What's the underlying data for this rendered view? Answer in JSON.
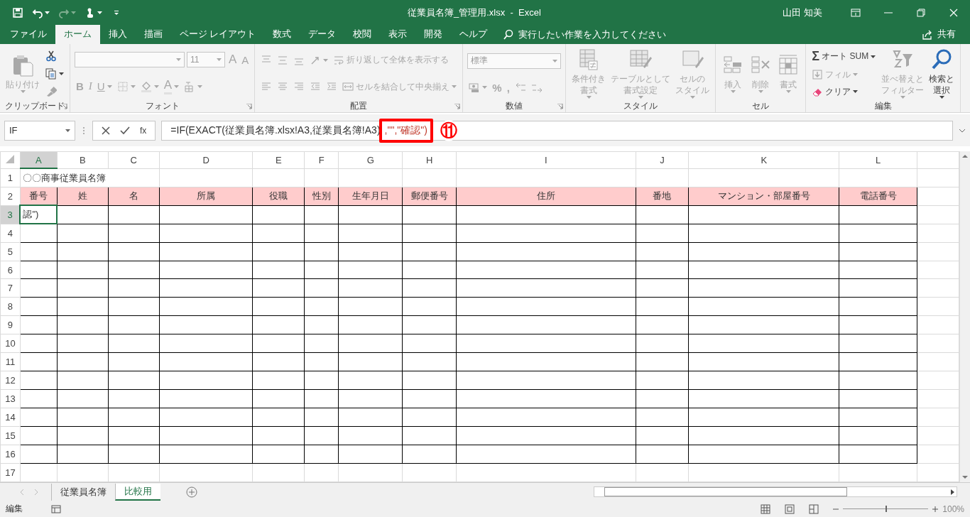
{
  "title_bar": {
    "title": "従業員名簿_管理用.xlsx  -  Excel",
    "user": "山田 知美"
  },
  "ribbon_tabs": [
    {
      "label": "ファイル",
      "selected": false
    },
    {
      "label": "ホーム",
      "selected": true
    },
    {
      "label": "挿入",
      "selected": false
    },
    {
      "label": "描画",
      "selected": false
    },
    {
      "label": "ページ レイアウト",
      "selected": false
    },
    {
      "label": "数式",
      "selected": false
    },
    {
      "label": "データ",
      "selected": false
    },
    {
      "label": "校閲",
      "selected": false
    },
    {
      "label": "表示",
      "selected": false
    },
    {
      "label": "開発",
      "selected": false
    },
    {
      "label": "ヘルプ",
      "selected": false
    }
  ],
  "tell_me": {
    "placeholder": "実行したい作業を入力してください"
  },
  "share": "共有",
  "ribbon_groups": [
    {
      "label": "クリップボード",
      "launcher": true,
      "sections": [
        {
          "rows": [
            [
              {
                "kind": "paste",
                "lines": [
                  "貼り付け"
                ],
                "disabled": true
              }
            ]
          ]
        },
        {
          "rows": [
            [
              {
                "kind": "cut",
                "disabled": false
              }
            ],
            [
              {
                "kind": "copy",
                "disabled": false
              }
            ],
            [
              {
                "kind": "painter",
                "disabled": true
              }
            ]
          ]
        }
      ]
    },
    {
      "label": "フォント",
      "launcher": true,
      "sections": [
        {
          "rows": [
            [
              {
                "kind": "fontname",
                "disabled": true
              },
              {
                "kind": "fontsize",
                "label": "11",
                "disabled": true
              },
              {
                "kind": "grow",
                "label": "A",
                "disabled": true
              },
              {
                "kind": "shrink",
                "label": "A",
                "disabled": true
              }
            ],
            [
              {
                "kind": "bold",
                "label": "B",
                "disabled": true
              },
              {
                "kind": "italic",
                "label": "I",
                "disabled": true
              },
              {
                "kind": "underline",
                "label": "U",
                "disabled": true
              },
              {
                "kind": "borders",
                "disabled": true
              },
              {
                "kind": "fill",
                "disabled": true
              },
              {
                "kind": "fontcolor",
                "label": "A",
                "disabled": true
              },
              {
                "kind": "phonetic",
                "disabled": true
              }
            ]
          ]
        }
      ]
    },
    {
      "label": "配置",
      "launcher": true,
      "sections": [
        {
          "rows": [
            [
              {
                "kind": "aligntop",
                "disabled": true
              },
              {
                "kind": "alignmiddle",
                "disabled": true
              },
              {
                "kind": "alignbottom",
                "disabled": true
              },
              {
                "kind": "orientation",
                "disabled": true
              },
              {
                "kind": "wrap",
                "label": "折り返して全体を表示する",
                "disabled": true
              }
            ],
            [
              {
                "kind": "alignleft",
                "disabled": true
              },
              {
                "kind": "aligncenter",
                "disabled": true
              },
              {
                "kind": "alignright",
                "disabled": true
              },
              {
                "kind": "outdent",
                "disabled": true
              },
              {
                "kind": "indent",
                "disabled": true
              },
              {
                "kind": "merge",
                "label": "セルを結合して中央揃え",
                "disabled": true
              }
            ]
          ]
        }
      ]
    },
    {
      "label": "数値",
      "launcher": true,
      "sections": [
        {
          "rows": [
            [
              {
                "kind": "numformat",
                "label": "標準",
                "disabled": true
              }
            ],
            [
              {
                "kind": "currency",
                "disabled": true
              },
              {
                "kind": "glyph",
                "label": "%",
                "disabled": true
              },
              {
                "kind": "glyph",
                "label": ",",
                "disabled": true
              },
              {
                "kind": "incdec",
                "disabled": true
              },
              {
                "kind": "decdec",
                "disabled": true
              }
            ]
          ]
        }
      ]
    },
    {
      "label": "スタイル",
      "launcher": false,
      "sections": [
        {
          "rows": [
            [
              {
                "kind": "condformat",
                "lines": [
                  "条件付き",
                  "書式"
                ],
                "disabled": true
              },
              {
                "kind": "tablefmt",
                "lines": [
                  "テーブルとして",
                  "書式設定"
                ],
                "disabled": true
              },
              {
                "kind": "cellstyle",
                "lines": [
                  "セルの",
                  "スタイル"
                ],
                "disabled": true
              }
            ]
          ]
        }
      ]
    },
    {
      "label": "セル",
      "launcher": false,
      "sections": [
        {
          "rows": [
            [
              {
                "kind": "insert",
                "lines": [
                  "挿入"
                ],
                "disabled": true
              },
              {
                "kind": "delete",
                "lines": [
                  "削除"
                ],
                "disabled": true
              },
              {
                "kind": "format",
                "lines": [
                  "書式"
                ],
                "disabled": true
              }
            ]
          ]
        }
      ]
    },
    {
      "label": "編集",
      "launcher": false,
      "sections": [
        {
          "rows": [
            [
              {
                "kind": "autosum",
                "symbol": "Σ",
                "label": "オート SUM",
                "disabled": false
              }
            ],
            [
              {
                "kind": "fillbtn",
                "label": "フィル",
                "disabled": true
              }
            ],
            [
              {
                "kind": "clear",
                "label": "クリア",
                "disabled": false
              }
            ]
          ]
        },
        {
          "rows": [
            [
              {
                "kind": "sort",
                "lines": [
                  "並べ替えと",
                  "フィルター"
                ],
                "disabled": true
              },
              {
                "kind": "find",
                "lines": [
                  "検索と",
                  "選択"
                ],
                "disabled": false
              }
            ]
          ]
        }
      ]
    }
  ],
  "formula_bar": {
    "name_box": "IF",
    "fx": "fx",
    "formula": [
      {
        "text": "=IF(EXACT(従業員名簿.xlsx!A3,従業員名簿!A3)",
        "highlighted": false
      },
      {
        "text": ",\"\",\"確認\")",
        "highlighted": true
      }
    ],
    "annotation": "⑪"
  },
  "grid": {
    "columns": [
      {
        "letter": "A",
        "selected": true
      },
      {
        "letter": "B",
        "selected": false
      },
      {
        "letter": "C",
        "selected": false
      },
      {
        "letter": "D",
        "selected": false
      },
      {
        "letter": "E",
        "selected": false
      },
      {
        "letter": "F",
        "selected": false
      },
      {
        "letter": "G",
        "selected": false
      },
      {
        "letter": "H",
        "selected": false
      },
      {
        "letter": "I",
        "selected": false
      },
      {
        "letter": "J",
        "selected": false
      },
      {
        "letter": "K",
        "selected": false
      },
      {
        "letter": "L",
        "selected": false
      }
    ],
    "rows": [
      {
        "number": "1",
        "selected": false,
        "kind": "title",
        "text": "〇〇商事従業員名簿"
      },
      {
        "number": "2",
        "selected": false,
        "kind": "header",
        "cells": [
          "番号",
          "姓",
          "名",
          "所属",
          "役職",
          "性別",
          "生年月日",
          "郵便番号",
          "住所",
          "番地",
          "マンション・部屋番号",
          "電話番号"
        ]
      },
      {
        "number": "3",
        "selected": true,
        "kind": "table",
        "text": "認\")"
      },
      {
        "number": "4",
        "selected": false,
        "kind": "table"
      },
      {
        "number": "5",
        "selected": false,
        "kind": "table"
      },
      {
        "number": "6",
        "selected": false,
        "kind": "table"
      },
      {
        "number": "7",
        "selected": false,
        "kind": "table"
      },
      {
        "number": "8",
        "selected": false,
        "kind": "table"
      },
      {
        "number": "9",
        "selected": false,
        "kind": "table"
      },
      {
        "number": "10",
        "selected": false,
        "kind": "table"
      },
      {
        "number": "11",
        "selected": false,
        "kind": "table"
      },
      {
        "number": "12",
        "selected": false,
        "kind": "table"
      },
      {
        "number": "13",
        "selected": false,
        "kind": "table"
      },
      {
        "number": "14",
        "selected": false,
        "kind": "table"
      },
      {
        "number": "15",
        "selected": false,
        "kind": "table"
      },
      {
        "number": "16",
        "selected": false,
        "kind": "table"
      },
      {
        "number": "17",
        "selected": false,
        "kind": "plain"
      }
    ]
  },
  "sheet_tabs": [
    {
      "label": "従業員名簿",
      "selected": false
    },
    {
      "label": "比較用",
      "selected": true
    }
  ],
  "status_bar": {
    "mode": "編集",
    "zoom": "100%",
    "zoom_slider": {
      "level": 0.5
    }
  }
}
